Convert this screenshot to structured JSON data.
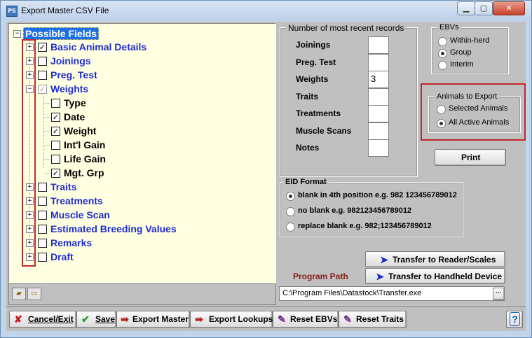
{
  "window": {
    "title": "Export Master CSV File",
    "app_icon_text": "PS",
    "minimize": "▁",
    "maximize": "▢",
    "close": "✕"
  },
  "tree": {
    "root": "Possible Fields",
    "items": [
      {
        "label": "Basic Animal Details",
        "checked": true,
        "expander": "+"
      },
      {
        "label": "Joinings",
        "checked": false,
        "expander": "+"
      },
      {
        "label": "Preg. Test",
        "checked": false,
        "expander": "+"
      },
      {
        "label": "Weights",
        "checked": true,
        "expander": "−",
        "gray": true,
        "children": [
          {
            "label": "Type",
            "checked": false
          },
          {
            "label": "Date",
            "checked": true
          },
          {
            "label": "Weight",
            "checked": true
          },
          {
            "label": "Int'l Gain",
            "checked": false
          },
          {
            "label": "Life Gain",
            "checked": false
          },
          {
            "label": "Mgt. Grp",
            "checked": true
          }
        ]
      },
      {
        "label": "Traits",
        "checked": false,
        "expander": "+"
      },
      {
        "label": "Treatments",
        "checked": false,
        "expander": "+"
      },
      {
        "label": "Muscle Scan",
        "checked": false,
        "expander": "+"
      },
      {
        "label": "Estimated Breeding Values",
        "checked": false,
        "expander": "+"
      },
      {
        "label": "Remarks",
        "checked": false,
        "expander": "+"
      },
      {
        "label": "Draft",
        "checked": false,
        "expander": "+"
      }
    ]
  },
  "records": {
    "title": "Number of most recent records",
    "rows": [
      {
        "label": "Joinings",
        "value": ""
      },
      {
        "label": "Preg. Test",
        "value": ""
      },
      {
        "label": "Weights",
        "value": "3"
      },
      {
        "label": "Traits",
        "value": ""
      },
      {
        "label": "Treatments",
        "value": ""
      },
      {
        "label": "Muscle Scans",
        "value": ""
      },
      {
        "label": "Notes",
        "value": ""
      }
    ]
  },
  "ebvs": {
    "title": "EBVs",
    "options": [
      "Within-herd",
      "Group",
      "Interim"
    ],
    "selected": "Group"
  },
  "animals": {
    "title": "Animals to Export",
    "options": [
      "Selected Animals",
      "All Active Animals"
    ],
    "selected": "All Active Animals"
  },
  "print_label": "Print",
  "eid": {
    "title": "EID Format",
    "options": [
      "blank in 4th position e.g. 982 123456789012",
      "no blank e.g. 982123456789012",
      "replace blank e.g. 982;123456789012"
    ],
    "selected": "blank in 4th position e.g. 982 123456789012"
  },
  "transfer_reader": "Transfer to Reader/Scales",
  "transfer_handheld": "Transfer to Handheld Device",
  "program_path_label": "Program Path",
  "program_path": "C:\\Program Files\\Datastock\\Transfer.exe",
  "browse": "···",
  "bottom": {
    "cancel": "Cancel/Exit",
    "save": "Save",
    "export_master": "Export Master",
    "export_lookups": "Export Lookups",
    "reset_ebvs": "Reset EBVs",
    "reset_traits": "Reset Traits",
    "help": "?"
  }
}
